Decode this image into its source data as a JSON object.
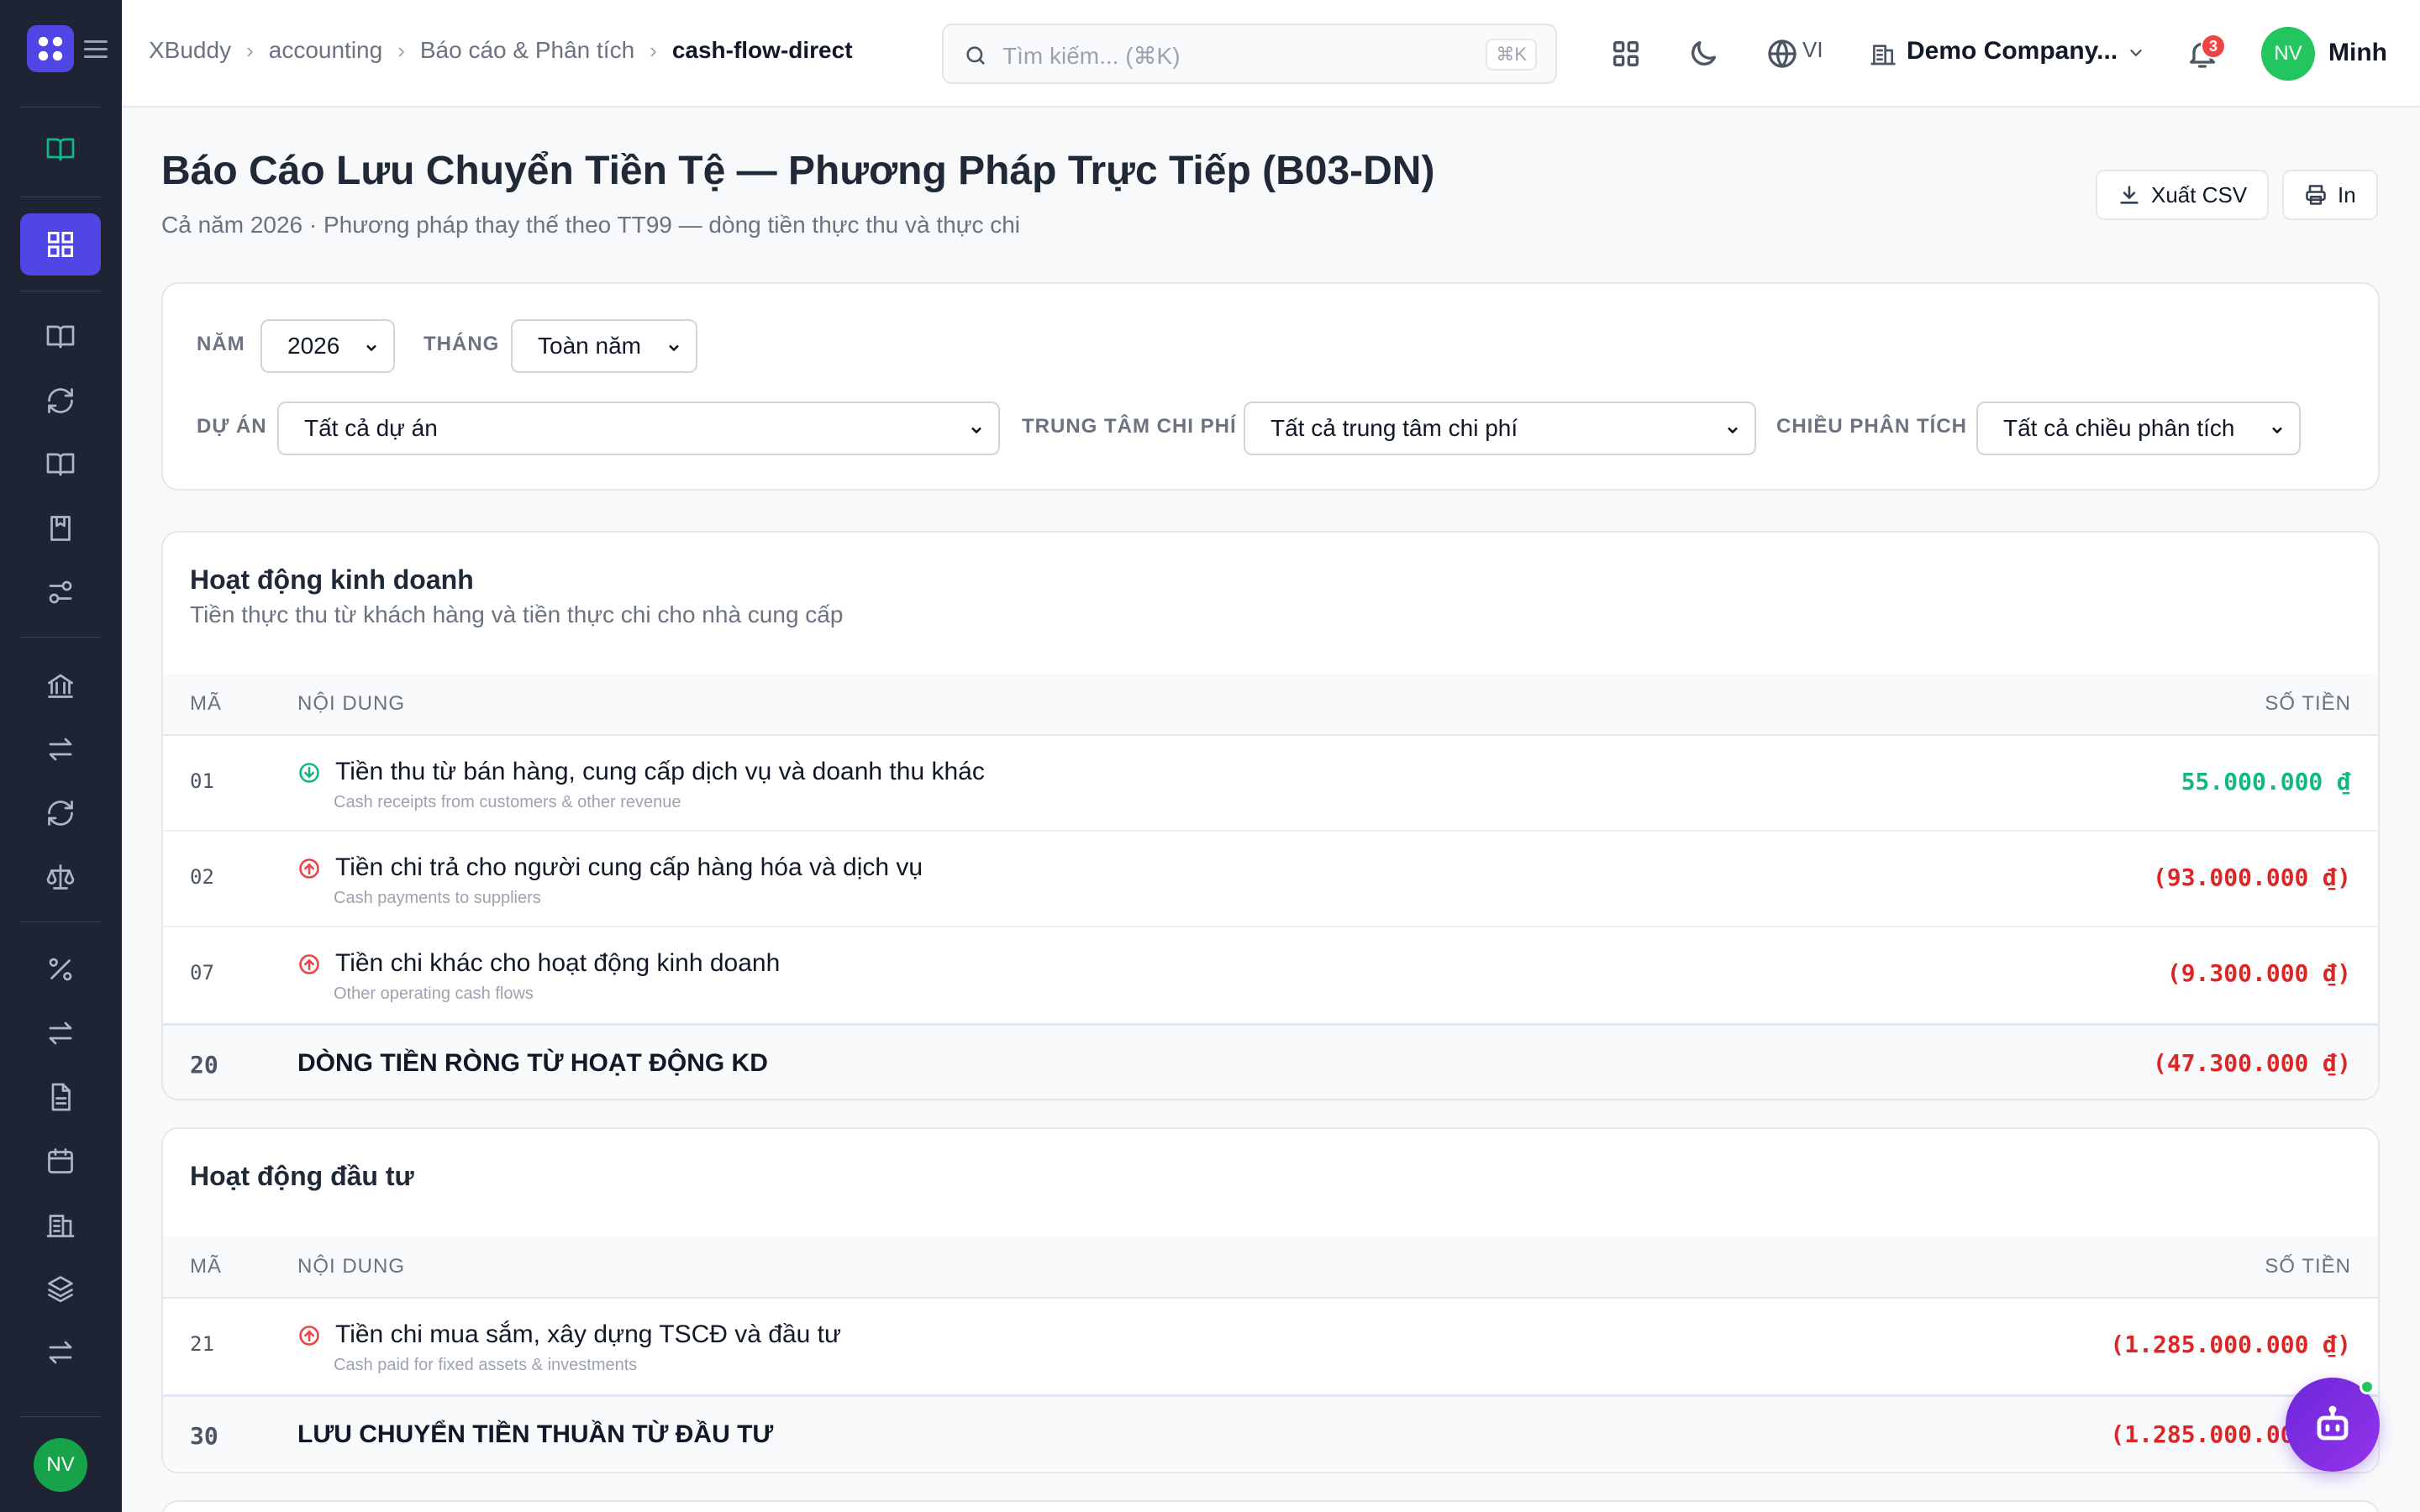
{
  "breadcrumb": [
    "XBuddy",
    "accounting",
    "Báo cáo & Phân tích",
    "cash-flow-direct"
  ],
  "search": {
    "placeholder": "Tìm kiếm... (⌘K)",
    "shortcut": "⌘K"
  },
  "topbar": {
    "language": "VI",
    "company": "Demo Company...",
    "notifications": "3",
    "user_initials": "NV",
    "user_name": "Minh"
  },
  "sidebar": {
    "user_initials": "NV"
  },
  "page": {
    "title": "Báo Cáo Lưu Chuyển Tiền Tệ — Phương Pháp Trực Tiếp (B03-DN)",
    "subtitle": "Cả năm 2026 · Phương pháp thay thế theo TT99 — dòng tiền thực thu và thực chi",
    "export_label": "Xuất CSV",
    "print_label": "In"
  },
  "filters": {
    "year_label": "NĂM",
    "year_value": "2026",
    "month_label": "THÁNG",
    "month_value": "Toàn năm",
    "project_label": "DỰ ÁN",
    "project_value": "Tất cả dự án",
    "cost_center_label": "TRUNG TÂM CHI PHÍ",
    "cost_center_value": "Tất cả trung tâm chi phí",
    "dimension_label": "CHIỀU PHÂN TÍCH",
    "dimension_value": "Tất cả chiều phân tích"
  },
  "table_headers": {
    "code": "MÃ",
    "content": "NỘI DUNG",
    "amount": "SỐ TIỀN"
  },
  "operating": {
    "title": "Hoạt động kinh doanh",
    "subtitle": "Tiền thực thu từ khách hàng và tiền thực chi cho nhà cung cấp",
    "rows": [
      {
        "code": "01",
        "name": "Tiền thu từ bán hàng, cung cấp dịch vụ và doanh thu khác",
        "desc": "Cash receipts from customers & other revenue",
        "amount": "55.000.000 ₫",
        "direction": "in"
      },
      {
        "code": "02",
        "name": "Tiền chi trả cho người cung cấp hàng hóa và dịch vụ",
        "desc": "Cash payments to suppliers",
        "amount": "(93.000.000 ₫)",
        "direction": "out"
      },
      {
        "code": "07",
        "name": "Tiền chi khác cho hoạt động kinh doanh",
        "desc": "Other operating cash flows",
        "amount": "(9.300.000 ₫)",
        "direction": "out"
      }
    ],
    "total": {
      "code": "20",
      "name": "DÒNG TIỀN RÒNG TỪ HOẠT ĐỘNG KD",
      "amount": "(47.300.000 ₫)"
    }
  },
  "investing": {
    "title": "Hoạt động đầu tư",
    "rows": [
      {
        "code": "21",
        "name": "Tiền chi mua sắm, xây dựng TSCĐ và đầu tư",
        "desc": "Cash paid for fixed assets & investments",
        "amount": "(1.285.000.000 ₫)",
        "direction": "out"
      }
    ],
    "total": {
      "code": "30",
      "name": "LƯU CHUYỂN TIỀN THUẦN TỪ ĐẦU TƯ",
      "amount": "(1.285.000.000 ₫)"
    }
  },
  "colors": {
    "accent": "#4f46e5",
    "positive": "#10b981",
    "negative": "#dc2626",
    "sidebar": "#1e2433"
  }
}
